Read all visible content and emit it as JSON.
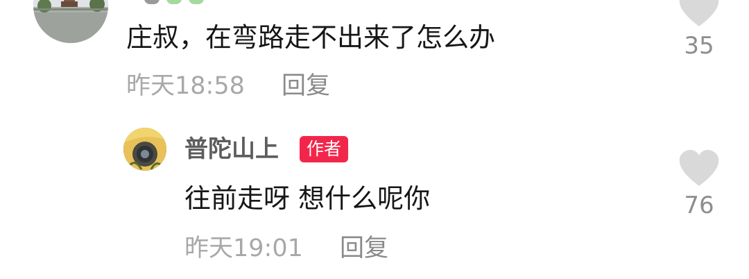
{
  "comment": {
    "text": "庄叔，在弯路走不出来了怎么办",
    "time": "昨天18:58",
    "reply_label": "回复",
    "likes": "35",
    "heart_icon": "heart-icon"
  },
  "reply": {
    "author": "普陀山上",
    "badge": "作者",
    "text": "往前走呀 想什么呢你",
    "time": "昨天19:01",
    "reply_label": "回复",
    "likes": "76",
    "heart_icon": "heart-icon"
  },
  "colors": {
    "badge_bg": "#f2264b",
    "text_primary": "#161616",
    "text_meta": "#a8a8a8",
    "heart": "#d9d9d9"
  }
}
